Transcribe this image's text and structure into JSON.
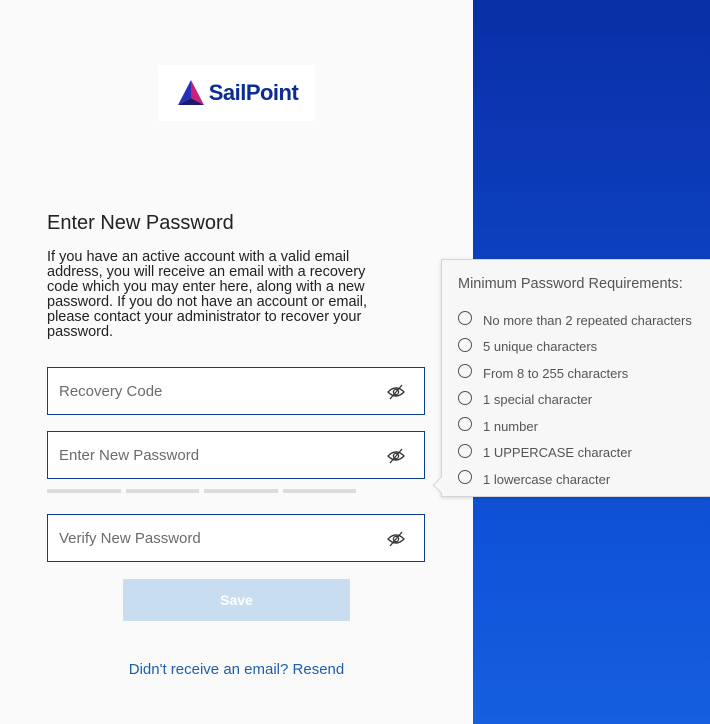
{
  "logo": {
    "text": "SailPoint"
  },
  "form": {
    "title": "Enter New Password",
    "description": "If you have an active account with a valid email address, you will receive an email with a recovery code which you may enter here, along with a new password. If you do not have an account or email, please contact your administrator to recover your password.",
    "recovery_code": {
      "placeholder": "Recovery Code",
      "value": ""
    },
    "new_password": {
      "placeholder": "Enter New Password",
      "value": ""
    },
    "verify_password": {
      "placeholder": "Verify New Password",
      "value": ""
    },
    "password_strength_level": 0,
    "save_label": "Save",
    "resend_label": "Didn't receive an email? Resend"
  },
  "requirements": {
    "title": "Minimum Password Requirements:",
    "items": [
      "No more than 2 repeated characters",
      "5 unique characters",
      "From 8 to 255 characters",
      "1 special character",
      "1 number",
      "1 UPPERCASE character",
      "1 lowercase character"
    ]
  },
  "icons": {
    "visibility_toggle": "eye-slash-icon",
    "requirement_status": "radio-empty-icon"
  },
  "colors": {
    "brand_blue": "#0b2d91",
    "field_border": "#0b3d91",
    "save_disabled": "#c9ddf1",
    "link": "#1f5fa8"
  }
}
